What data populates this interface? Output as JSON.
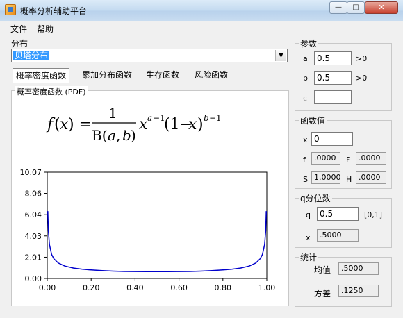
{
  "window": {
    "title": "概率分析辅助平台",
    "minimize_glyph": "—",
    "maximize_glyph": "□",
    "close_glyph": "✕"
  },
  "menu": {
    "file": "文件",
    "help": "帮助"
  },
  "distribution": {
    "label": "分布",
    "selected": "贝塔分布",
    "dropdown_arrow": "▼"
  },
  "tabs": [
    "概率密度函数",
    "累加分布函数",
    "生存函数",
    "风险函数"
  ],
  "pdf_panel": {
    "caption": "概率密度函数 (PDF)"
  },
  "params": {
    "title": "参数",
    "a_label": "a",
    "a_value": "0.5",
    "a_hint": ">0",
    "b_label": "b",
    "b_value": "0.5",
    "b_hint": ">0",
    "c_label": "c",
    "c_value": ""
  },
  "funcvals": {
    "title": "函数值",
    "x_label": "x",
    "x_value": "0",
    "f_label": "f",
    "f_value": ".0000",
    "F_label": "F",
    "F_value": ".0000",
    "S_label": "S",
    "S_value": "1.0000",
    "H_label": "H",
    "H_value": ".0000"
  },
  "quantile": {
    "title": "q分位数",
    "q_label": "q",
    "q_value": "0.5",
    "q_range": "[0,1]",
    "x_label": "x",
    "x_value": ".5000"
  },
  "stats": {
    "title": "统计",
    "mean_label": "均值",
    "mean_value": ".5000",
    "var_label": "方差",
    "var_value": ".1250"
  },
  "chart_data": {
    "type": "line",
    "title": "",
    "xlabel": "",
    "ylabel": "",
    "xlim": [
      0,
      1
    ],
    "ylim": [
      0,
      10.07
    ],
    "x_ticks": [
      "0.00",
      "0.20",
      "0.40",
      "0.60",
      "0.80",
      "1.00"
    ],
    "y_ticks": [
      "0.00",
      "2.01",
      "4.03",
      "6.04",
      "8.06",
      "10.07"
    ],
    "grid": false,
    "line_color": "#0000cc",
    "series": [
      {
        "x": [
          0.0025,
          0.005,
          0.01,
          0.02,
          0.03,
          0.05,
          0.08,
          0.12,
          0.16,
          0.2,
          0.25,
          0.3,
          0.35,
          0.4,
          0.45,
          0.5,
          0.55,
          0.6,
          0.65,
          0.7,
          0.75,
          0.8,
          0.84,
          0.88,
          0.92,
          0.95,
          0.97,
          0.98,
          0.99,
          0.995,
          0.9975
        ],
        "y": [
          6.38,
          4.51,
          3.2,
          2.27,
          1.87,
          1.46,
          1.17,
          0.98,
          0.87,
          0.8,
          0.74,
          0.69,
          0.66,
          0.65,
          0.64,
          0.64,
          0.64,
          0.65,
          0.66,
          0.69,
          0.74,
          0.8,
          0.87,
          0.98,
          1.17,
          1.46,
          1.87,
          2.27,
          3.2,
          4.51,
          6.38
        ]
      }
    ]
  }
}
